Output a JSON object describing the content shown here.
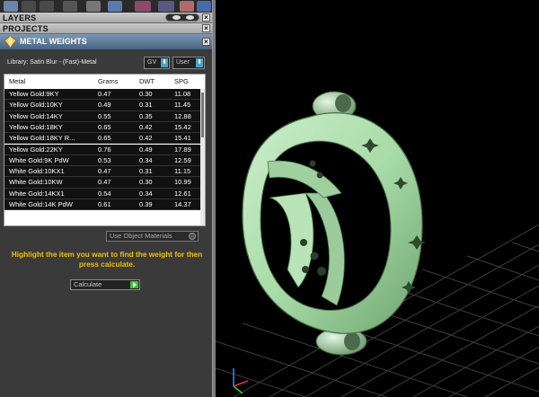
{
  "panels": {
    "layers_title": "LAYERS",
    "projects_title": "PROJECTS",
    "metal_weights_title": "METAL WEIGHTS"
  },
  "library": {
    "label": "Library: Satin Blur - (Fast)-Metal",
    "gv_label": "GV",
    "user_label": "User"
  },
  "table": {
    "headers": [
      "Metal",
      "Grams",
      "DWT",
      "SPG"
    ],
    "rows": [
      [
        "Yellow Gold:9KY",
        "0.47",
        "0.30",
        "11.08"
      ],
      [
        "Yellow Gold:10KY",
        "0.49",
        "0.31",
        "11.45"
      ],
      [
        "Yellow Gold:14KY",
        "0.55",
        "0.35",
        "12.88"
      ],
      [
        "Yellow Gold:18KY",
        "0.65",
        "0.42",
        "15.42"
      ],
      [
        "Yellow Gold:18KY R...",
        "0.65",
        "0.42",
        "15.41"
      ],
      [
        "Yellow Gold:22KY",
        "0.76",
        "0.49",
        "17.89"
      ],
      [
        "White Gold:9K PdW",
        "0.53",
        "0.34",
        "12.59"
      ],
      [
        "White Gold:10KX1",
        "0.47",
        "0.31",
        "11.15"
      ],
      [
        "White Gold:10KW",
        "0.47",
        "0.30",
        "10.99"
      ],
      [
        "White Gold:14KX1",
        "0.54",
        "0.34",
        "12.61"
      ],
      [
        "White Gold:14K PdW",
        "0.61",
        "0.39",
        "14.37"
      ]
    ]
  },
  "use_object_materials": "Use Object Materials",
  "hint": "Highlight the item you want to find the weight for then press calculate.",
  "calculate_label": "Calculate",
  "colors": {
    "panel_bg": "#3a3a3a",
    "hint_yellow": "#f0c000",
    "model_green": "#a8dca8",
    "grid": "#3d3d3d"
  }
}
